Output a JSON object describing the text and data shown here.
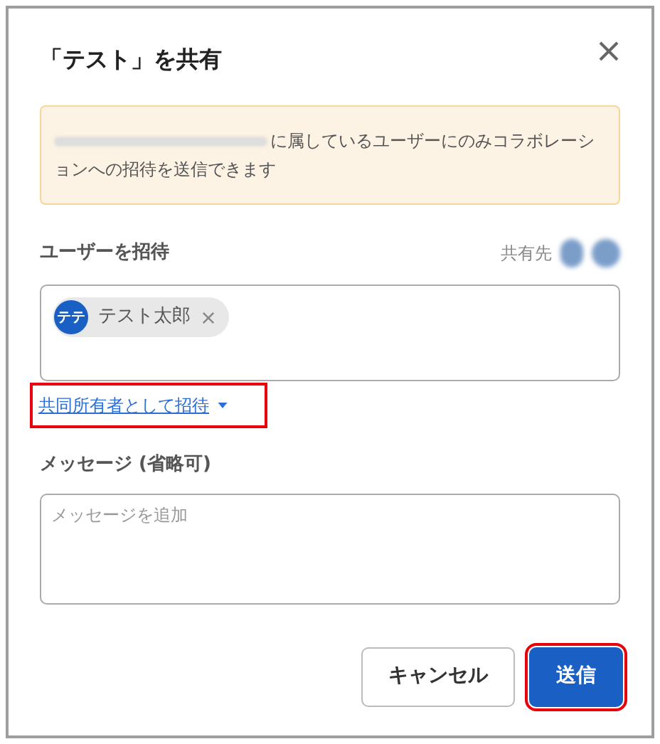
{
  "dialog": {
    "title": "「テスト」を共有"
  },
  "notice": {
    "text": "に属しているユーザーにのみコラボレーションへの招待を送信できます",
    "redacted_prefix": true
  },
  "invite": {
    "label": "ユーザーを招待",
    "shared_with_label": "共有先",
    "chips": [
      {
        "initials": "テテ",
        "name": "テスト太郎",
        "color": "#1a5fc4"
      }
    ]
  },
  "role_link": {
    "text": "共同所有者として招待",
    "highlighted": true
  },
  "message": {
    "label": "メッセージ (省略可)",
    "placeholder": "メッセージを追加"
  },
  "buttons": [
    {
      "label": "キャンセル",
      "kind": "secondary",
      "highlighted": false
    },
    {
      "label": "送信",
      "kind": "primary",
      "highlighted": true
    }
  ]
}
